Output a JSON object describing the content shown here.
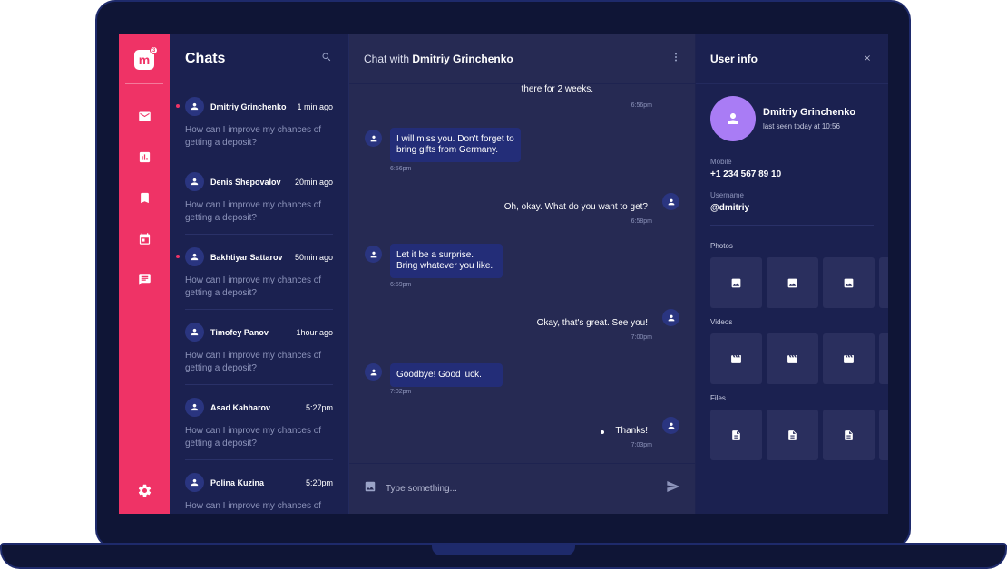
{
  "app": {
    "logo_letter": "m",
    "logo_badge": "3"
  },
  "chats": {
    "title": "Chats",
    "items": [
      {
        "name": "Dmitriy Grinchenko",
        "time": "1 min ago",
        "preview": "How can I improve my chances of getting a deposit?",
        "unread": true
      },
      {
        "name": "Denis Shepovalov",
        "time": "20min ago",
        "preview": "How can I improve my chances of getting a deposit?",
        "unread": false
      },
      {
        "name": "Bakhtiyar Sattarov",
        "time": "50min ago",
        "preview": "How can I improve my chances of getting a deposit?",
        "unread": true
      },
      {
        "name": "Timofey Panov",
        "time": "1hour ago",
        "preview": "How can I improve my chances of getting a deposit?",
        "unread": false
      },
      {
        "name": "Asad Kahharov",
        "time": "5:27pm",
        "preview": "How can I improve my chances of getting a deposit?",
        "unread": false
      },
      {
        "name": "Polina Kuzina",
        "time": "5:20pm",
        "preview": "How can I improve my chances of getting a deposit?",
        "unread": false
      }
    ]
  },
  "conversation": {
    "title_prefix": "Chat with",
    "contact": "Dmitriy Grinchenko",
    "messages": [
      {
        "dir": "out",
        "text": "there for 2 weeks.",
        "time": "6:56pm"
      },
      {
        "dir": "in",
        "text": "I will miss you. Don't forget to bring gifts from Germany.",
        "time": "6:56pm"
      },
      {
        "dir": "out",
        "text": "Oh, okay. What do you want to get?",
        "time": "6:58pm"
      },
      {
        "dir": "in",
        "text": "Let it be a surprise. Bring whatever you like.",
        "time": "6:59pm"
      },
      {
        "dir": "out",
        "text": "Okay, that's great. See you!",
        "time": "7:00pm"
      },
      {
        "dir": "in",
        "text": "Goodbye! Good luck.",
        "time": "7:02pm"
      },
      {
        "dir": "out",
        "text": "Thanks!",
        "time": "7:03pm"
      }
    ],
    "input_placeholder": "Type something..."
  },
  "user_info": {
    "title": "User info",
    "name": "Dmitriy Grinchenko",
    "status": "last seen today at 10:56",
    "mobile_label": "Mobile",
    "mobile": "+1 234 567 89 10",
    "username_label": "Username",
    "username": "@dmitriy",
    "photos_label": "Photos",
    "videos_label": "Videos",
    "files_label": "Files"
  },
  "icons": {
    "sidebar": [
      "mail-icon",
      "chart-icon",
      "bookmark-icon",
      "calendar-icon",
      "chat-icon",
      "settings-icon"
    ],
    "accent": "#ef3366"
  }
}
